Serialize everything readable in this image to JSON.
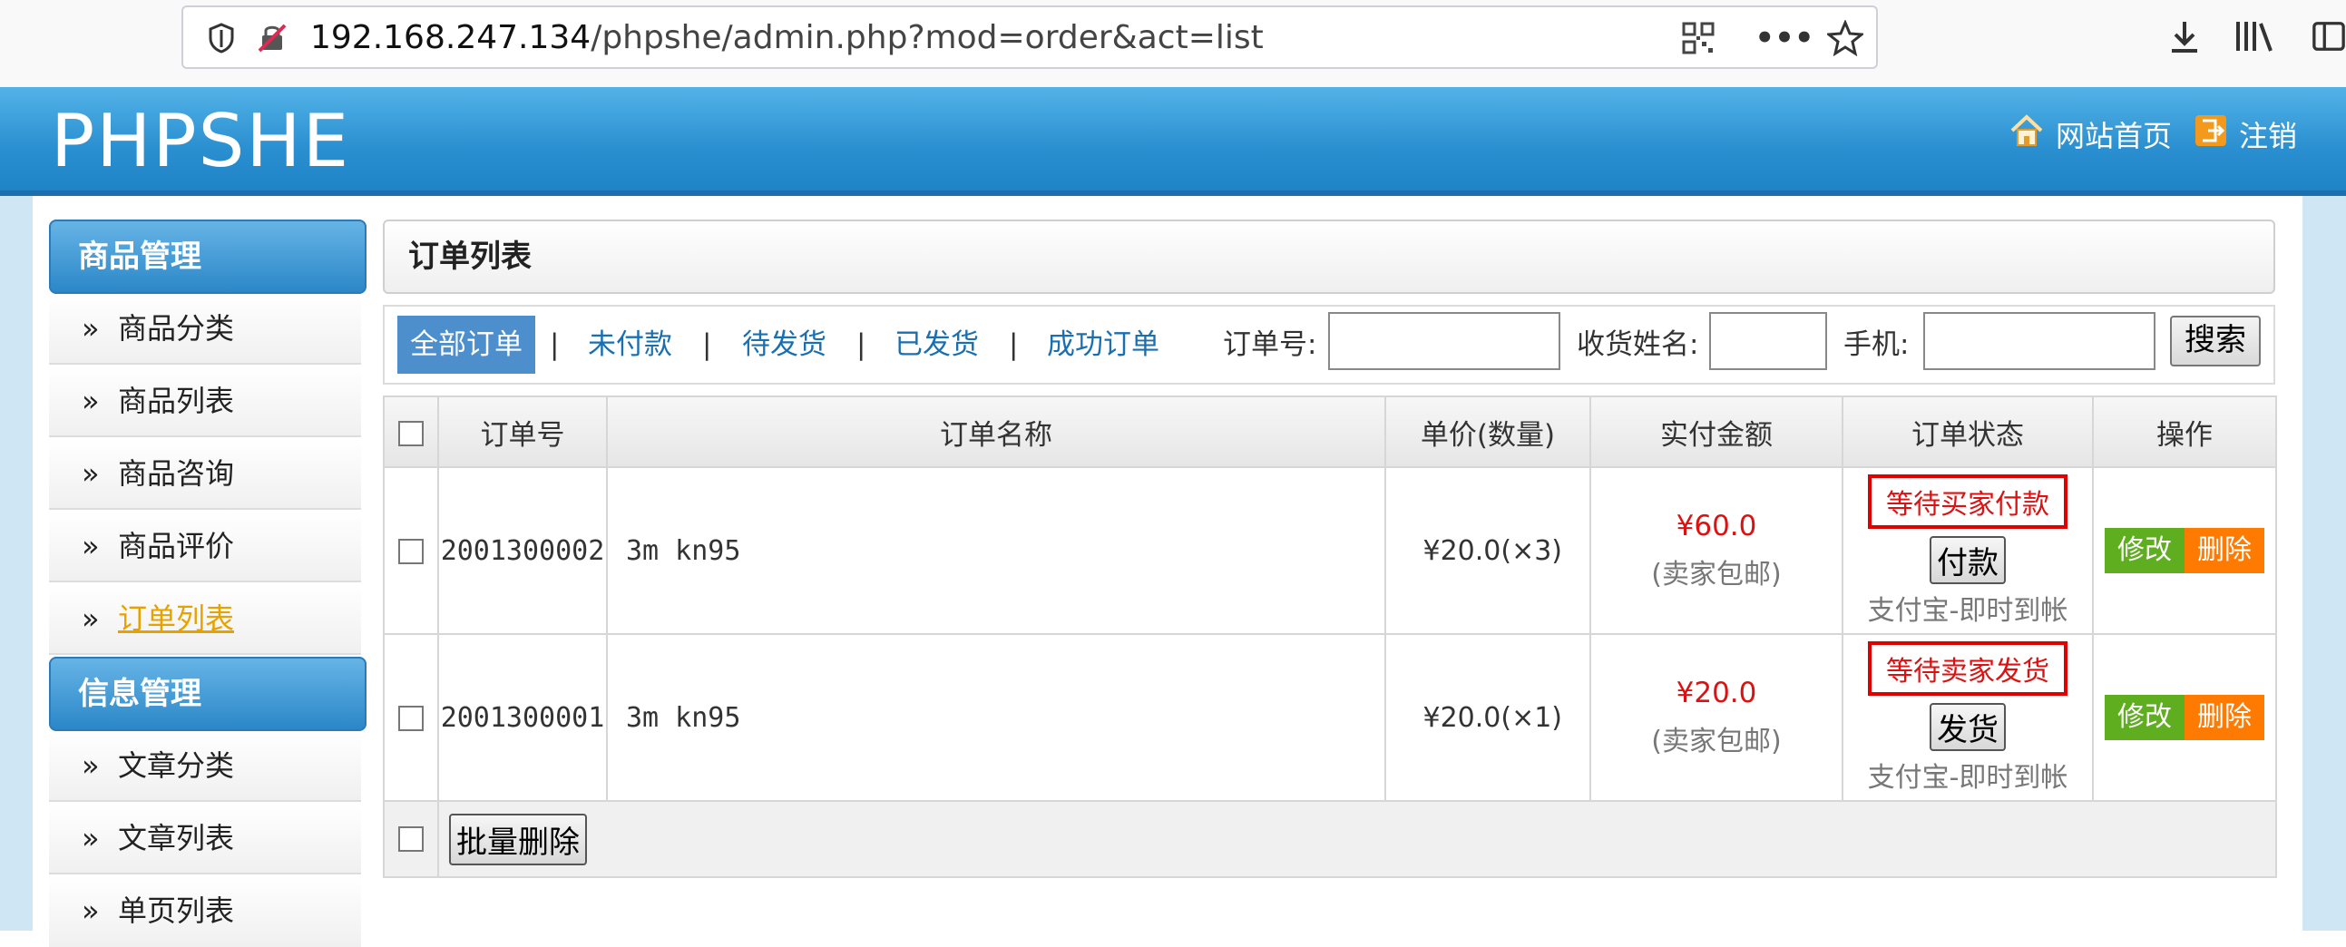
{
  "browser": {
    "url_host": "192.168.247.134",
    "url_path": "/phpshe/admin.php?mod=order&act=list"
  },
  "header": {
    "logo": "PHPSHE",
    "home_link": "网站首页",
    "logout_link": "注销"
  },
  "sidebar": {
    "groups": [
      {
        "title": "商品管理",
        "items": [
          "商品分类",
          "商品列表",
          "商品咨询",
          "商品评价",
          "订单列表"
        ]
      },
      {
        "title": "信息管理",
        "items": [
          "文章分类",
          "文章列表",
          "单页列表"
        ]
      }
    ],
    "active_item": "订单列表",
    "arrow": "»"
  },
  "main": {
    "title": "订单列表",
    "filter_tabs": [
      "全部订单",
      "未付款",
      "待发货",
      "已发货",
      "成功订单"
    ],
    "active_tab": "全部订单",
    "separator": "|",
    "search": {
      "order_no_label": "订单号:",
      "name_label": "收货姓名:",
      "phone_label": "手机:",
      "order_no_value": "",
      "name_value": "",
      "phone_value": "",
      "button": "搜索"
    },
    "table": {
      "headers": [
        "订单号",
        "订单名称",
        "单价(数量)",
        "实付金额",
        "订单状态",
        "操作"
      ],
      "rows": [
        {
          "order_no": "2001300002",
          "name": "3m kn95",
          "price": "¥20.0(×3)",
          "amount": "¥60.0",
          "shipping": "(卖家包邮)",
          "status": "等待买家付款",
          "action_button": "付款",
          "payment": "支付宝-即时到帐",
          "edit": "修改",
          "delete": "删除"
        },
        {
          "order_no": "2001300001",
          "name": "3m kn95",
          "price": "¥20.0(×1)",
          "amount": "¥20.0",
          "shipping": "(卖家包邮)",
          "status": "等待卖家发货",
          "action_button": "发货",
          "payment": "支付宝-即时到帐",
          "edit": "修改",
          "delete": "删除"
        }
      ],
      "bulk_delete": "批量删除"
    }
  },
  "colors": {
    "header_blue": "#2a8fd0",
    "status_red": "#e00000",
    "edit_green": "#5fae20",
    "delete_orange": "#ff7a00",
    "active_orange": "#e7a100"
  }
}
